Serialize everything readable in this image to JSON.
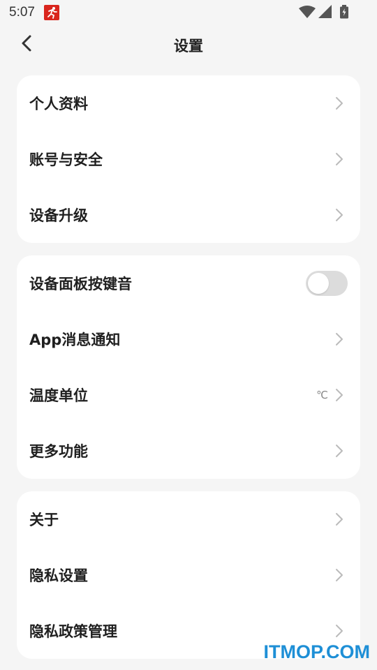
{
  "status_bar": {
    "time": "5:07",
    "app_icon": "running-man-icon",
    "icons": [
      "wifi-icon",
      "signal-icon",
      "battery-icon"
    ]
  },
  "header": {
    "title": "设置",
    "back_icon": "back-arrow-icon"
  },
  "groups": [
    {
      "items": [
        {
          "label": "个人资料"
        },
        {
          "label": "账号与安全"
        },
        {
          "label": "设备升级"
        }
      ]
    },
    {
      "items": [
        {
          "label": "设备面板按键音",
          "toggle": false
        },
        {
          "label": "App消息通知"
        },
        {
          "label": "温度单位",
          "value": "℃"
        },
        {
          "label": "更多功能"
        }
      ]
    },
    {
      "items": [
        {
          "label": "关于"
        },
        {
          "label": "隐私设置"
        },
        {
          "label": "隐私政策管理"
        }
      ]
    }
  ],
  "watermark": "ITMOP.COM",
  "colors": {
    "background": "#f5f5f5",
    "card": "#ffffff",
    "toggle_off": "#dcdcdc",
    "watermark": "#1e8fd6",
    "app_icon": "#d9251d"
  }
}
